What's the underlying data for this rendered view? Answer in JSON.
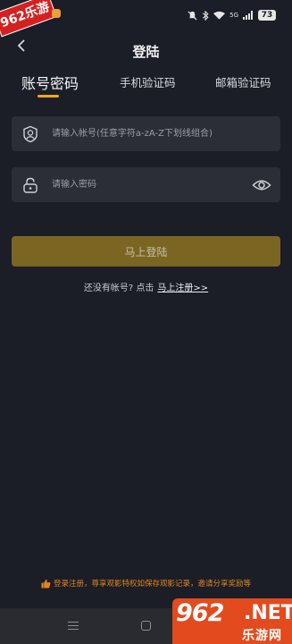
{
  "status_bar": {
    "watermark": "962乐游",
    "signal_label": "5G",
    "battery": "73"
  },
  "header": {
    "title": "登陆"
  },
  "tabs": [
    {
      "label": "账号密码",
      "active": true
    },
    {
      "label": "手机验证码",
      "active": false
    },
    {
      "label": "邮箱验证码",
      "active": false
    }
  ],
  "form": {
    "account_placeholder": "请输入帐号(任意字符a-zA-Z下划线组合)",
    "password_placeholder": "请输入密码",
    "login_label": "马上登陆",
    "register_prompt": "还没有帐号? 点击",
    "register_link": "马上注册>>"
  },
  "footer": {
    "tip": "登录注册，尊享观影特权如保存观影记录，邀请分享奖励等"
  },
  "site_logo": {
    "number": "962",
    "suffix": ".NET",
    "subtitle": "乐游网"
  },
  "colors": {
    "background": "#1b1d27",
    "accent": "#f0a91a",
    "button": "#7b6522",
    "tip": "#e4831e",
    "field": "#2b2d37"
  }
}
